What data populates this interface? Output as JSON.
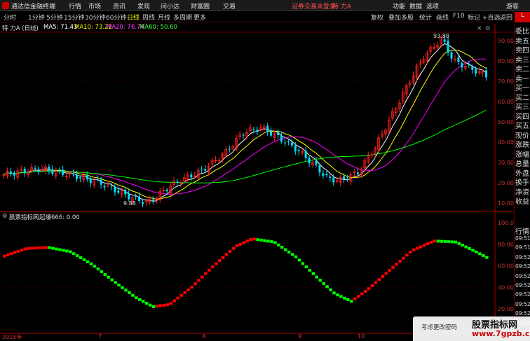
{
  "topbar": {
    "app_name": "通达信金融终端",
    "menu": [
      "行情",
      "市场",
      "资讯",
      "发现",
      "问小达",
      "财富圈",
      "交易"
    ],
    "notice": "证券交易未登录",
    "stock_name": "特 力A",
    "right_menu": [
      "功能",
      "数据",
      "选项"
    ],
    "user": "游客"
  },
  "timeframes": [
    "分时",
    "1分钟",
    "5分钟",
    "15分钟",
    "30分钟",
    "60分钟",
    "日线",
    "周线",
    "月线",
    "多周期",
    "更多"
  ],
  "active_timeframe": "日线",
  "right_tools": [
    "复权",
    "叠加",
    "多股",
    "统计",
    "画线",
    "F10",
    "标记",
    "+自选",
    "返回"
  ],
  "ma_bar": {
    "title": "特 力A (日线)",
    "ma5": "MA5: 71.43",
    "ma10": "MA10: 73.22",
    "ma20": "MA20: 76.74",
    "ma60": "MA60: 50.60"
  },
  "indicator_bar": {
    "source": "股票指标网",
    "value": "起爆666: 0.00"
  },
  "price_axis": [
    "90.00",
    "80.00",
    "70.00",
    "60.00",
    "50.00",
    "40.00",
    "30.00",
    "20.00",
    "10.00"
  ],
  "indicator_axis": [
    "100.00",
    "80.00",
    "60.00",
    "40.00",
    "20.00"
  ],
  "annotations": {
    "high": "93.88",
    "low": "9.88"
  },
  "x_axis": [
    "2015年",
    "7",
    "8",
    "9",
    "10"
  ],
  "sidebar_top": [
    "委比",
    "卖五",
    "卖四",
    "卖三",
    "卖二",
    "卖一",
    "买一",
    "买二",
    "买三",
    "买四",
    "买五",
    "现价",
    "涨跌",
    "涨幅",
    "总量",
    "外盘",
    "换手",
    "净资",
    "收益"
  ],
  "sidebar_bottom_label": [
    "行情"
  ],
  "sidebar_times": [
    "09:51",
    "09:51",
    "09:52",
    "09:52",
    "09:52",
    "09:52",
    "09:52",
    "09:52",
    "09:52",
    "09:52",
    "09:52"
  ],
  "watermark": {
    "title": "股票指标网",
    "url": "www.7gpzb.com",
    "notice": "考虑更改密码"
  },
  "colors": {
    "up": "#ff2020",
    "down": "#00e0ff",
    "ma5": "#ffffff",
    "ma10": "#ffff00",
    "ma20": "#ff00ff",
    "ma60": "#00ff00",
    "indicator_up": "#ff0000",
    "indicator_down": "#00ff00"
  }
}
